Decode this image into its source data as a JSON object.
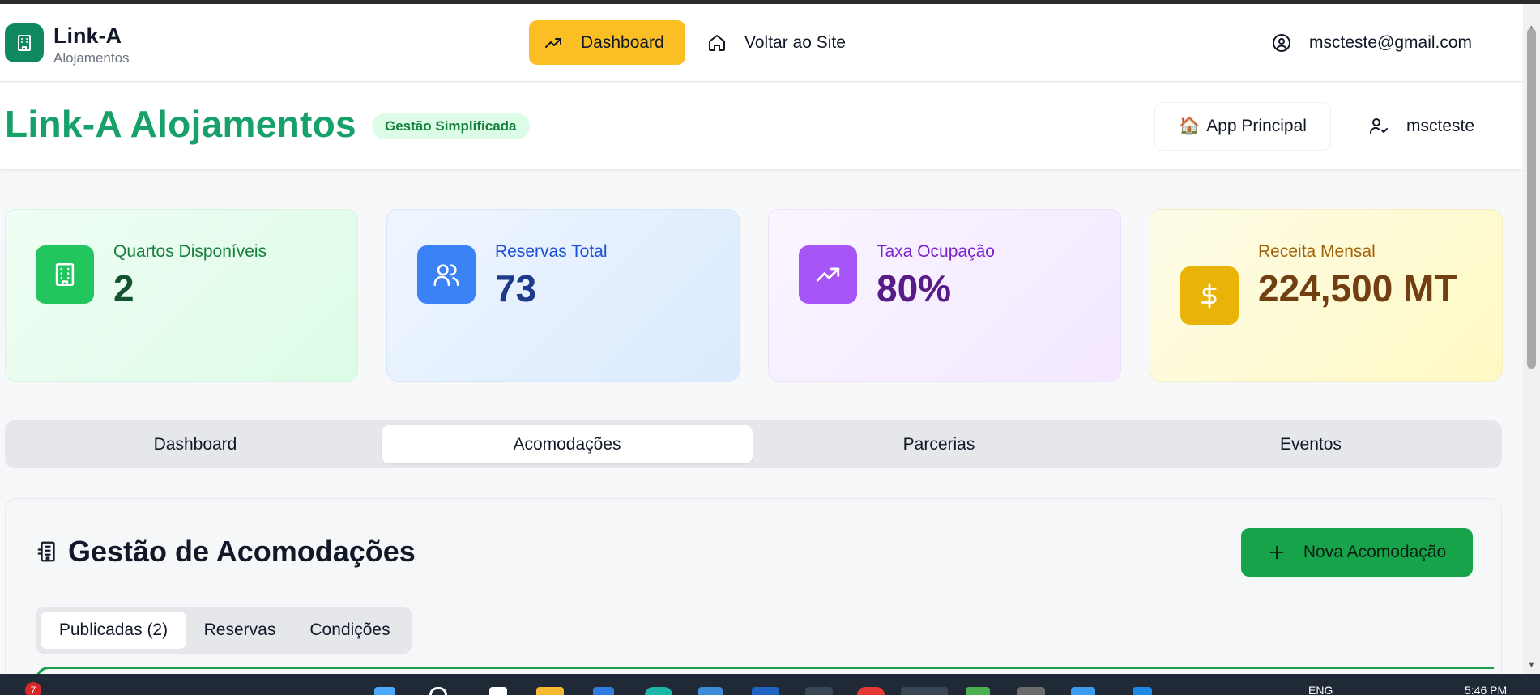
{
  "nav": {
    "brand_name": "Link-A",
    "brand_sub": "Alojamentos",
    "dashboard_label": "Dashboard",
    "site_label": "Voltar ao Site",
    "user_email": "mscteste@gmail.com"
  },
  "header": {
    "title": "Link-A Alojamentos",
    "badge": "Gestão Simplificada",
    "app_button": "App Principal",
    "app_emoji": "🏠",
    "username": "mscteste"
  },
  "stats": [
    {
      "label": "Quartos Disponíveis",
      "value": "2",
      "icon": "building-icon",
      "color": "#22c55e"
    },
    {
      "label": "Reservas Total",
      "value": "73",
      "icon": "users-icon",
      "color": "#3b82f6"
    },
    {
      "label": "Taxa Ocupação",
      "value": "80%",
      "icon": "trending-up-icon",
      "color": "#a855f7"
    },
    {
      "label": "Receita Mensal",
      "value": "224,500 MT",
      "icon": "dollar-icon",
      "color": "#eab308"
    }
  ],
  "tabs": [
    {
      "label": "Dashboard",
      "active": false
    },
    {
      "label": "Acomodações",
      "active": true
    },
    {
      "label": "Parcerias",
      "active": false
    },
    {
      "label": "Eventos",
      "active": false
    }
  ],
  "panel": {
    "title": "Gestão de Acomodações",
    "new_button": "Nova Acomodação",
    "subtabs": [
      {
        "label": "Publicadas (2)",
        "active": true
      },
      {
        "label": "Reservas",
        "active": false
      },
      {
        "label": "Condições",
        "active": false
      }
    ]
  },
  "taskbar": {
    "badge_count": "7",
    "language": "ENG",
    "time": "5:46 PM"
  }
}
